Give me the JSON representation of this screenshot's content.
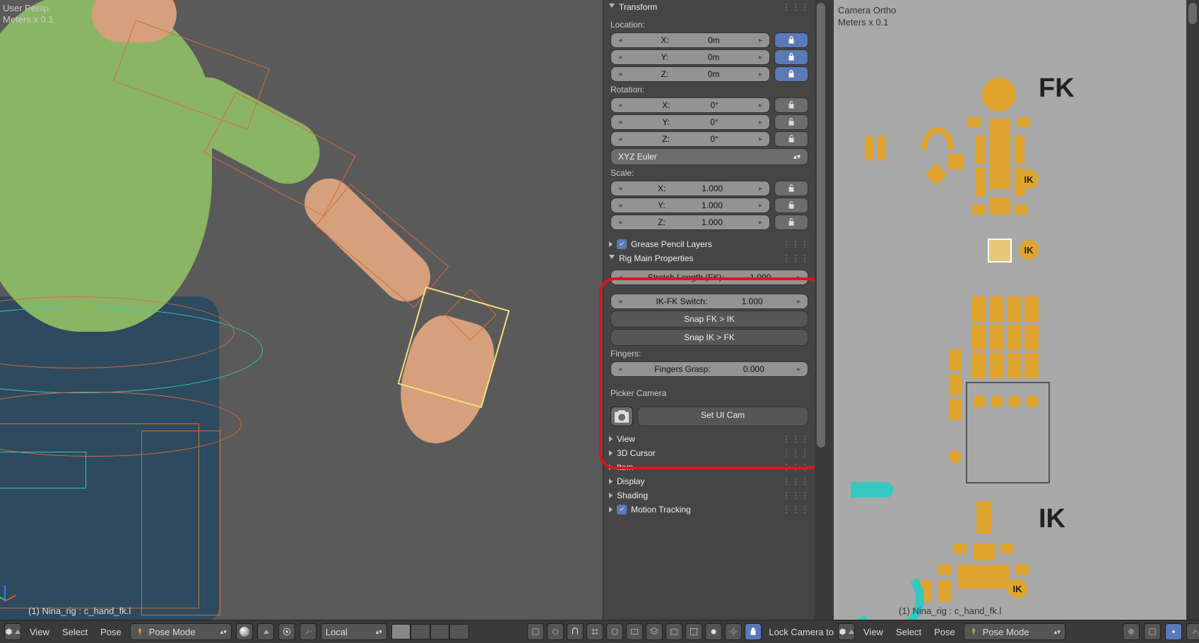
{
  "viewport_left": {
    "line1": "User Persp",
    "line2": "Meters x 0.1",
    "status": "(1) Nina_rig : c_hand_fk.l"
  },
  "viewport_right": {
    "line1": "Camera Ortho",
    "line2": "Meters x 0.1",
    "fk_label": "FK",
    "ik_label": "IK",
    "ik_badge": "IK",
    "status": "(1) Nina_rig : c_hand_fk.l"
  },
  "panel": {
    "transform": {
      "title": "Transform",
      "location_label": "Location:",
      "rotation_label": "Rotation:",
      "scale_label": "Scale:",
      "rot_mode": "XYZ Euler",
      "loc": {
        "x_label": "X:",
        "x_val": "0m",
        "y_label": "Y:",
        "y_val": "0m",
        "z_label": "Z:",
        "z_val": "0m"
      },
      "rot": {
        "x_label": "X:",
        "x_val": "0°",
        "y_label": "Y:",
        "y_val": "0°",
        "z_label": "Z:",
        "z_val": "0°"
      },
      "scale": {
        "x_label": "X:",
        "x_val": "1.000",
        "y_label": "Y:",
        "y_val": "1.000",
        "z_label": "Z:",
        "z_val": "1.000"
      }
    },
    "grease": {
      "title": "Grease Pencil Layers"
    },
    "rig": {
      "title": "Rig Main Properties",
      "stretch_label": "Stretch Length (FK):",
      "stretch_val": "1.000",
      "ikfk_label": "IK-FK Switch:",
      "ikfk_val": "1.000",
      "snap_fk_ik": "Snap FK > IK",
      "snap_ik_fk": "Snap IK > FK",
      "fingers_header": "Fingers:",
      "grasp_label": "Fingers Grasp:",
      "grasp_val": "0.000",
      "picker_camera": "Picker Camera"
    },
    "set_ui_cam": "Set UI Cam",
    "collapsed": {
      "view": "View",
      "cursor": "3D Cursor",
      "item": "Item",
      "display": "Display",
      "shading": "Shading",
      "motion": "Motion Tracking"
    }
  },
  "header_left": {
    "view": "View",
    "select": "Select",
    "pose": "Pose",
    "mode": "Pose Mode",
    "orient": "Local",
    "lock_cam": "Lock Camera to"
  },
  "header_right": {
    "view": "View",
    "select": "Select",
    "pose": "Pose",
    "mode": "Pose Mode"
  }
}
